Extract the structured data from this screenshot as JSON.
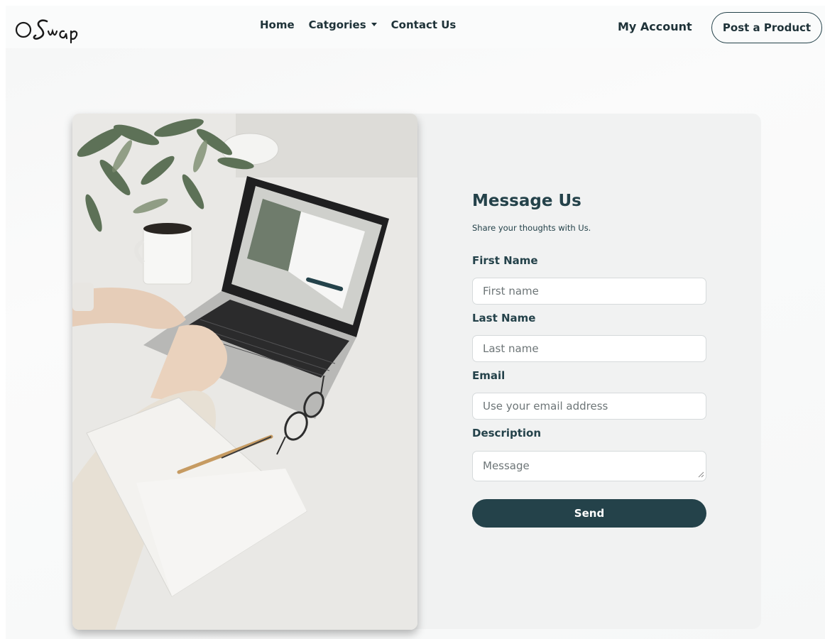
{
  "navbar": {
    "logo_text": "Swap",
    "links": [
      "Home",
      "Catgories",
      "Contact Us"
    ],
    "account_label": "My Account",
    "post_button_label": "Post a Product"
  },
  "form": {
    "title": "Message Us",
    "subtitle": "Share your thoughts with Us.",
    "fields": [
      {
        "label": "First Name",
        "placeholder": "First name",
        "value": ""
      },
      {
        "label": "Last Name",
        "placeholder": "Last name",
        "value": ""
      },
      {
        "label": "Email",
        "placeholder": "Use your email address",
        "value": ""
      },
      {
        "label": "Description",
        "placeholder": "Message",
        "value": ""
      }
    ],
    "submit_label": "Send"
  },
  "colors": {
    "primary": "#24424a",
    "card_background": "#f1f2f2",
    "page_background": "#f8f9f9"
  },
  "icons": {
    "logo": "swap-logo",
    "dropdown": "chevron-down-icon",
    "resize": "resize-grip-icon"
  },
  "image": {
    "subject": "laptop-on-desk-photo"
  }
}
